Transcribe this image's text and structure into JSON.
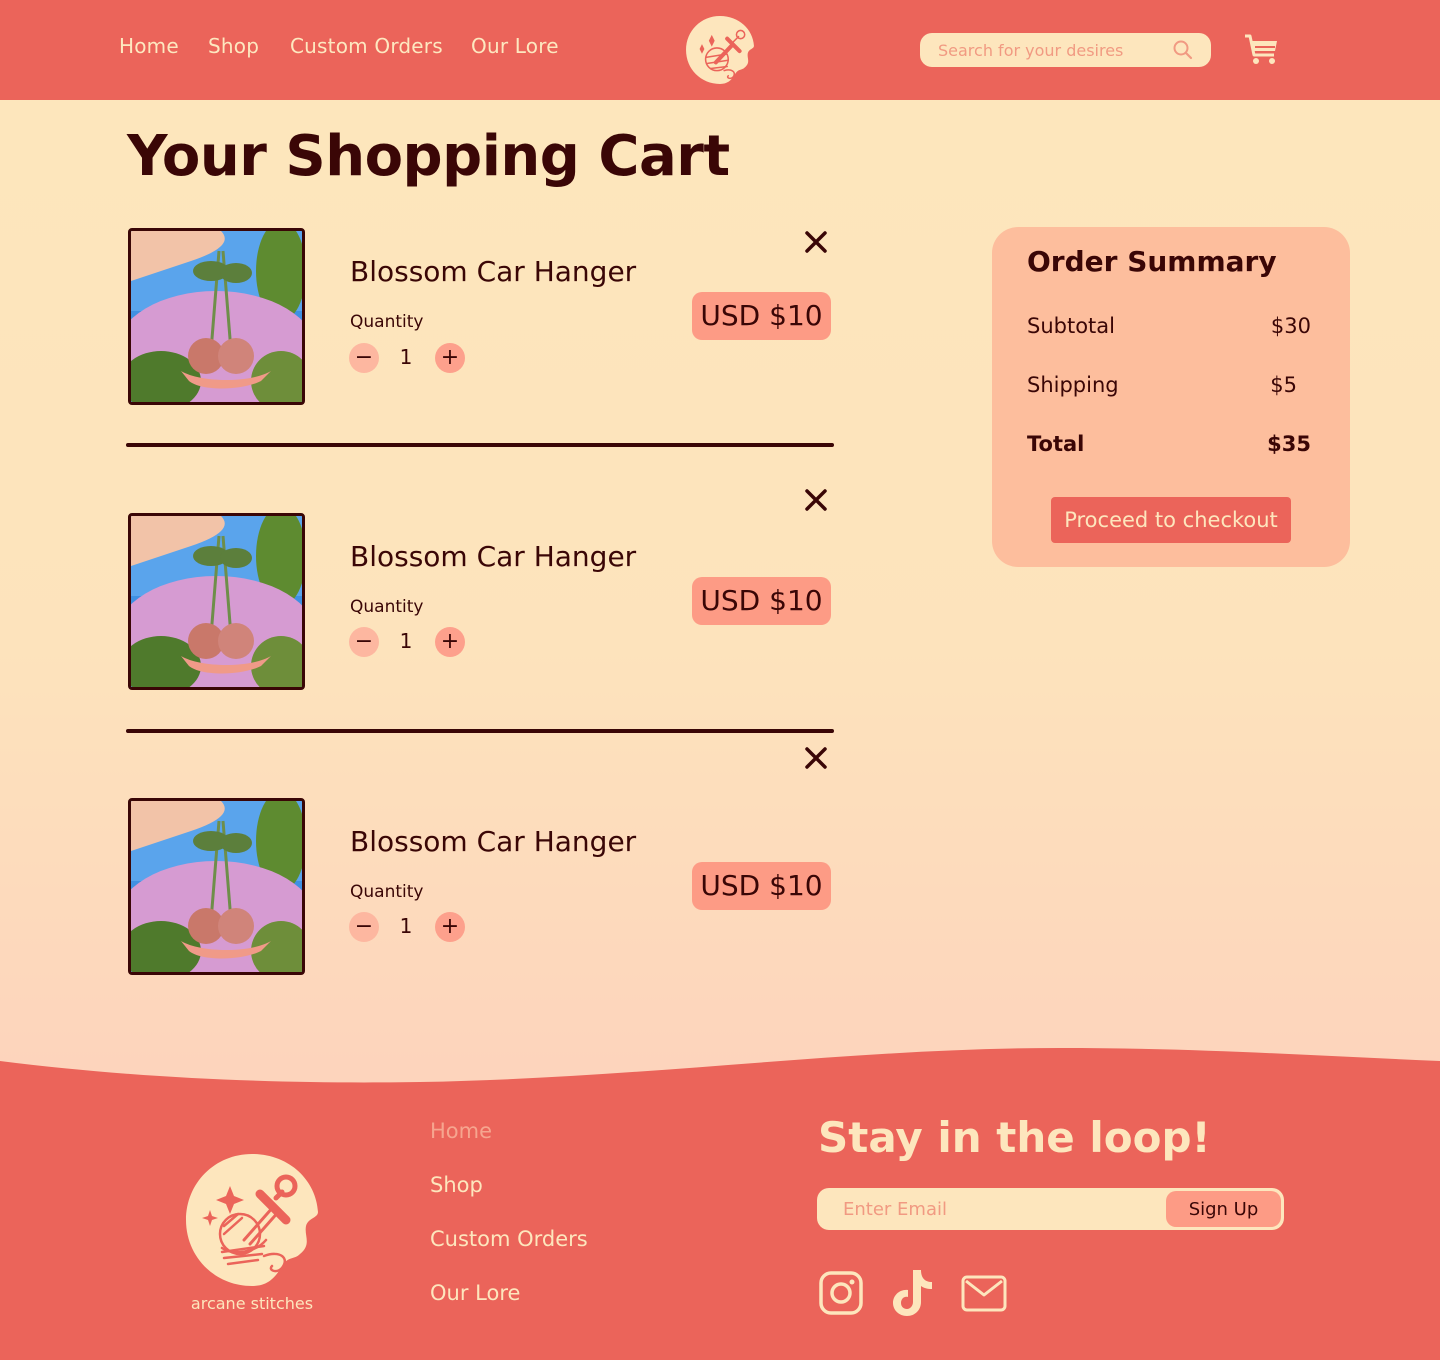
{
  "header": {
    "nav": [
      {
        "label": "Home"
      },
      {
        "label": "Shop"
      },
      {
        "label": "Custom Orders"
      },
      {
        "label": "Our Lore"
      }
    ],
    "logo_icon": "yarn-dagger-logo",
    "search": {
      "placeholder": "Search for your desires",
      "value": "",
      "icon": "search-icon"
    },
    "cart_icon": "cart-icon"
  },
  "page": {
    "title": "Your Shopping Cart"
  },
  "cart": {
    "quantity_label": "Quantity",
    "items": [
      {
        "name": "Blossom Car Hanger",
        "quantity": "1",
        "price": "USD $10",
        "image_alt": "Crocheted cherry blossom car hanger held in front of flowers"
      },
      {
        "name": "Blossom Car Hanger",
        "quantity": "1",
        "price": "USD $10",
        "image_alt": "Crocheted cherry blossom car hanger held in front of flowers"
      },
      {
        "name": "Blossom Car Hanger",
        "quantity": "1",
        "price": "USD $10",
        "image_alt": "Crocheted cherry blossom car hanger held in front of flowers"
      }
    ],
    "decrement_symbol": "−",
    "increment_symbol": "+"
  },
  "summary": {
    "title": "Order Summary",
    "rows": [
      {
        "label": "Subtotal",
        "value": "$30"
      },
      {
        "label": "Shipping",
        "value": "$5"
      },
      {
        "label": "Total",
        "value": "$35"
      }
    ],
    "checkout_label": "Proceed to checkout"
  },
  "footer": {
    "brand": "arcane stitches",
    "links": [
      {
        "label": "Home",
        "active": true
      },
      {
        "label": "Shop"
      },
      {
        "label": "Custom Orders"
      },
      {
        "label": "Our Lore"
      }
    ],
    "newsletter": {
      "title": "Stay in the loop!",
      "email_placeholder": "Enter Email",
      "signup_label": "Sign Up"
    },
    "social": [
      "instagram-icon",
      "tiktok-icon",
      "mail-icon"
    ]
  },
  "colors": {
    "primary": "#eb645a",
    "cream": "#fde6bd",
    "peach": "#fdbe9d",
    "salmon": "#fd9b85",
    "text": "#3a0606"
  }
}
